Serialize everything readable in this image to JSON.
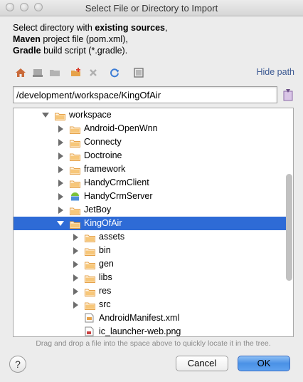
{
  "window": {
    "title": "Select File or Directory to Import"
  },
  "description": {
    "line1_prefix": "Select directory with ",
    "line1_bold": "existing sources",
    "line1_suffix": ",",
    "line2_bold": "Maven",
    "line2_suffix": " project file (pom.xml),",
    "line3_bold": "Gradle",
    "line3_suffix": " build script (*.gradle)."
  },
  "toolbar": {
    "icons": [
      "home-icon",
      "desktop-icon",
      "project-folder-icon",
      "new-folder-icon",
      "delete-icon",
      "refresh-icon",
      "show-hidden-icon"
    ],
    "hide_path_label": "Hide path"
  },
  "path": {
    "value": "/development/workspace/KingOfAir"
  },
  "tree": {
    "items": [
      {
        "label": "workspace",
        "expanded": true,
        "selected": false,
        "icon": "folder-icon"
      },
      {
        "label": "Android-OpenWnn",
        "expanded": false,
        "selected": false,
        "icon": "folder-icon"
      },
      {
        "label": "Connecty",
        "expanded": false,
        "selected": false,
        "icon": "folder-icon"
      },
      {
        "label": "Doctroine",
        "expanded": false,
        "selected": false,
        "icon": "folder-icon"
      },
      {
        "label": "framework",
        "expanded": false,
        "selected": false,
        "icon": "folder-icon"
      },
      {
        "label": "HandyCrmClient",
        "expanded": false,
        "selected": false,
        "icon": "folder-icon"
      },
      {
        "label": "HandyCrmServer",
        "expanded": false,
        "selected": false,
        "icon": "android-module-icon"
      },
      {
        "label": "JetBoy",
        "expanded": false,
        "selected": false,
        "icon": "folder-icon"
      },
      {
        "label": "KingOfAir",
        "expanded": true,
        "selected": true,
        "icon": "folder-icon"
      },
      {
        "label": "assets",
        "expanded": false,
        "selected": false,
        "icon": "folder-icon"
      },
      {
        "label": "bin",
        "expanded": false,
        "selected": false,
        "icon": "folder-icon"
      },
      {
        "label": "gen",
        "expanded": false,
        "selected": false,
        "icon": "folder-icon"
      },
      {
        "label": "libs",
        "expanded": false,
        "selected": false,
        "icon": "folder-icon"
      },
      {
        "label": "res",
        "expanded": false,
        "selected": false,
        "icon": "folder-icon"
      },
      {
        "label": "src",
        "expanded": false,
        "selected": false,
        "icon": "folder-icon"
      },
      {
        "label": "AndroidManifest.xml",
        "expanded": null,
        "selected": false,
        "icon": "xml-file-icon"
      },
      {
        "label": "ic_launcher-web.png",
        "expanded": null,
        "selected": false,
        "icon": "image-file-icon"
      }
    ]
  },
  "hint": "Drag and drop a file into the space above to quickly locate it in the tree.",
  "buttons": {
    "help": "?",
    "cancel": "Cancel",
    "ok": "OK"
  },
  "colors": {
    "selection": "#2e6bd6",
    "folder": "#e6a24a",
    "hide_path": "#3d5a93",
    "ok_button": "#4a91e6"
  }
}
